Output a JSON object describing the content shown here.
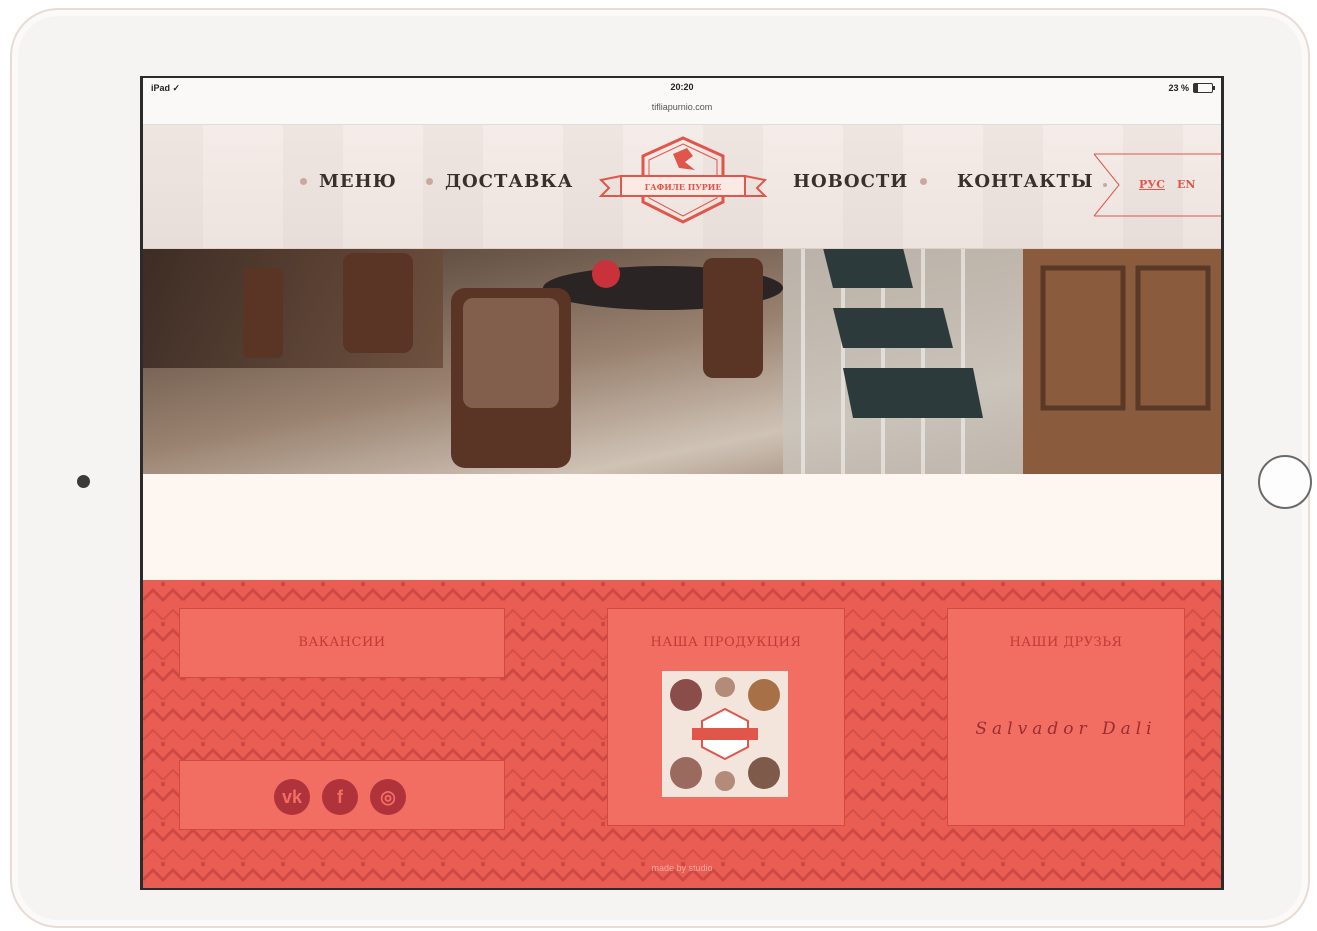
{
  "status_bar": {
    "carrier": "iPad ✓",
    "time": "20:20",
    "url": "tifliapurnio.com",
    "battery": "23 %"
  },
  "nav": {
    "menu": "МЕНЮ",
    "delivery": "ДОСТАВКА",
    "news": "НОВОСТИ",
    "contacts": "КОНТАКТЫ",
    "logo_text": "ГАФИЛЕ ПУРИЕ"
  },
  "lang": {
    "ru": "РУС",
    "en": "EN"
  },
  "footer": {
    "vacancies": "ВАКАНСИИ",
    "products": "НАША ПРОДУКЦИЯ",
    "friends": "НАШИ ДРУЗЬЯ",
    "partner": "Salvador Dali",
    "social": [
      {
        "label": "vk"
      },
      {
        "label": "f"
      },
      {
        "label": "◎"
      }
    ],
    "made_by": "made by studio"
  },
  "colors": {
    "brand_red": "#e95d52",
    "dark_red": "#b0323a"
  }
}
